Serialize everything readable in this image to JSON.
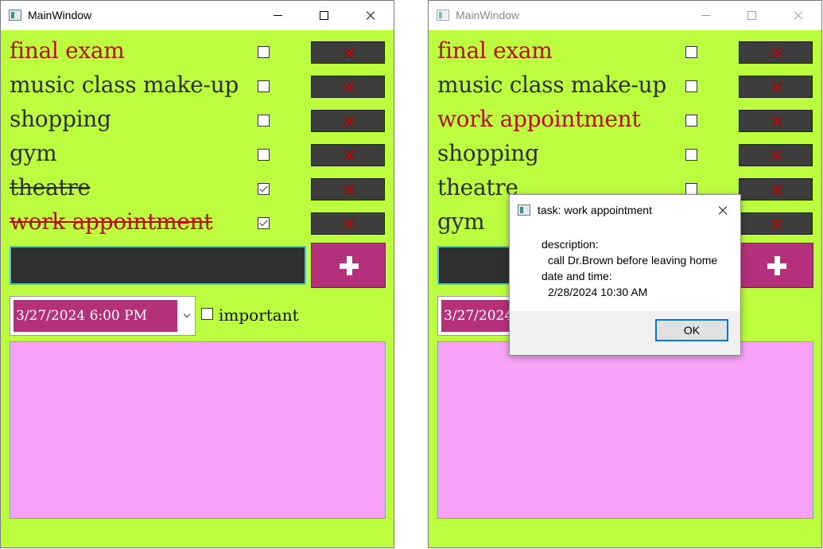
{
  "colors": {
    "window_bg": "#bcfd3f",
    "important_text": "#b5121b",
    "normal_text": "#2f2f2f",
    "delete_button": "#3d3d3d",
    "add_button": "#b5307a",
    "description_bg": "#f8a3f7",
    "input_bg": "#2f2f2f"
  },
  "left_window": {
    "title": "MainWindow",
    "tasks": [
      {
        "label": "final exam",
        "important": true,
        "done": false
      },
      {
        "label": "music class make-up",
        "important": false,
        "done": false
      },
      {
        "label": "shopping",
        "important": false,
        "done": false
      },
      {
        "label": "gym",
        "important": false,
        "done": false
      },
      {
        "label": "theatre",
        "important": false,
        "done": true
      },
      {
        "label": "work appointment",
        "important": true,
        "done": true
      }
    ],
    "new_task_input": "",
    "date_time": "3/27/2024 6:00 PM",
    "important_label": "important",
    "important_checked": false,
    "delete_icon": "red-x-icon",
    "add_icon": "plus-icon"
  },
  "right_window": {
    "title": "MainWindow",
    "tasks": [
      {
        "label": "final exam",
        "important": true,
        "done": false
      },
      {
        "label": "music class make-up",
        "important": false,
        "done": false
      },
      {
        "label": "work appointment",
        "important": true,
        "done": false
      },
      {
        "label": "shopping",
        "important": false,
        "done": false
      },
      {
        "label": "theatre",
        "important": false,
        "done": false
      },
      {
        "label": "gym",
        "important": false,
        "done": false
      }
    ],
    "date_time": "3/27/2024 6:00 PM"
  },
  "dialog": {
    "title": "task: work appointment",
    "description_label": "description:",
    "description_value": "call Dr.Brown before leaving home",
    "datetime_label": "date and time:",
    "datetime_value": "2/28/2024 10:30 AM",
    "ok_label": "OK"
  }
}
